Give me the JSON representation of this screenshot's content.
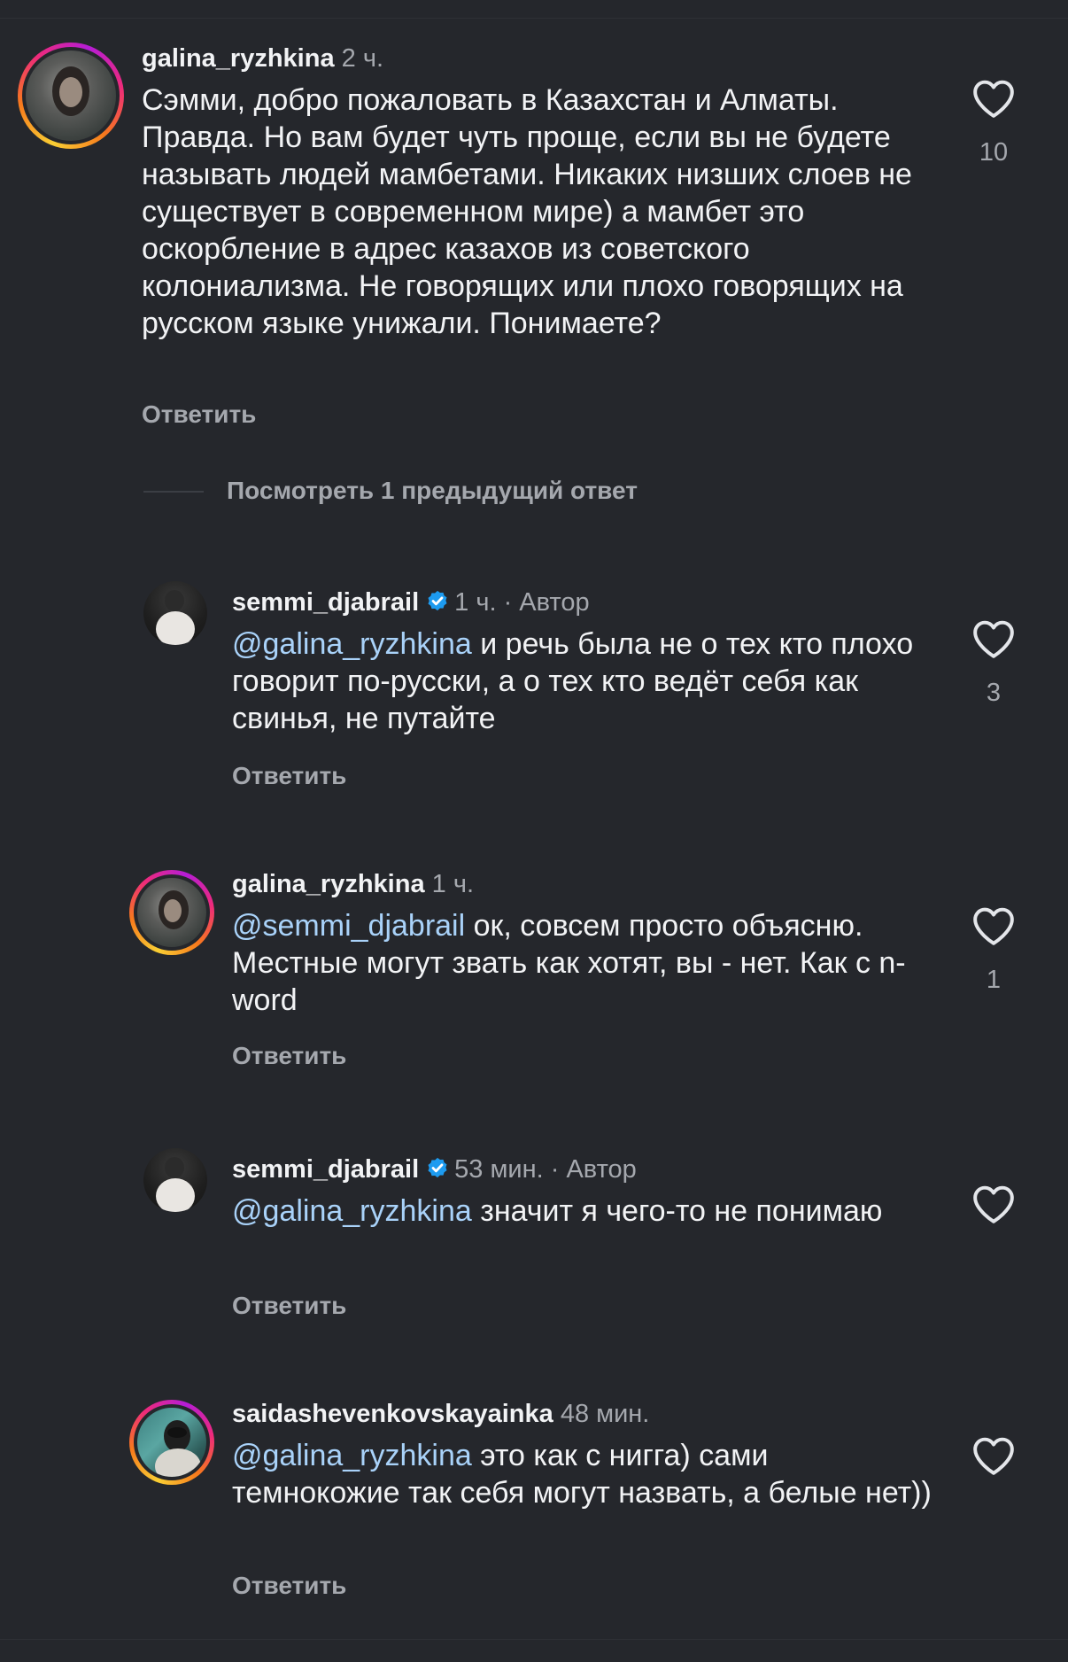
{
  "comments": [
    {
      "username": "galina_ryzhkina",
      "time": "2 ч.",
      "author_tag": "",
      "mention": "",
      "text": "Сэмми, добро пожаловать в Казахстан и Алматы. Правда. Но вам будет чуть проще, если вы не будете называть людей мамбетами. Никаких низших слоев не существует в современном мире) а мамбет это оскорбление в адрес казахов из советского колониализма. Не говорящих или плохо говорящих на русском языке унижали. Понимаете?",
      "reply_label": "Ответить",
      "likes": "10"
    },
    {
      "username": "semmi_djabrail",
      "time": "1 ч.",
      "author_tag": " · Автор",
      "mention": "@galina_ryzhkina",
      "text": " и речь была не о тех кто плохо говорит по-русски, а о тех кто ведёт себя как свинья, не путайте",
      "reply_label": "Ответить",
      "likes": "3"
    },
    {
      "username": "galina_ryzhkina",
      "time": "1 ч.",
      "author_tag": "",
      "mention": "@semmi_djabrail",
      "text": " ок, совсем просто объясню. Местные могут звать как хотят, вы - нет. Как с n-word",
      "reply_label": "Ответить",
      "likes": "1"
    },
    {
      "username": "semmi_djabrail",
      "time": "53 мин.",
      "author_tag": " · Автор",
      "mention": "@galina_ryzhkina",
      "text": " значит я чего-то не понимаю",
      "reply_label": "Ответить",
      "likes": ""
    },
    {
      "username": "saidashevenkovskayainka",
      "time": "48 мин.",
      "author_tag": "",
      "mention": "@galina_ryzhkina",
      "text": " это как с нигга) сами темнокожие так себя могут назвать, а белые нет))",
      "reply_label": "Ответить",
      "likes": ""
    }
  ],
  "view_previous": "Посмотреть 1 предыдущий ответ",
  "icons": {
    "like": "heart-outline-icon",
    "verified": "verified-badge-icon"
  },
  "colors": {
    "background": "#25272c",
    "mention": "#a9d2f9",
    "verified": "#1d9bf0",
    "secondary_text": "#a5a8ae"
  }
}
